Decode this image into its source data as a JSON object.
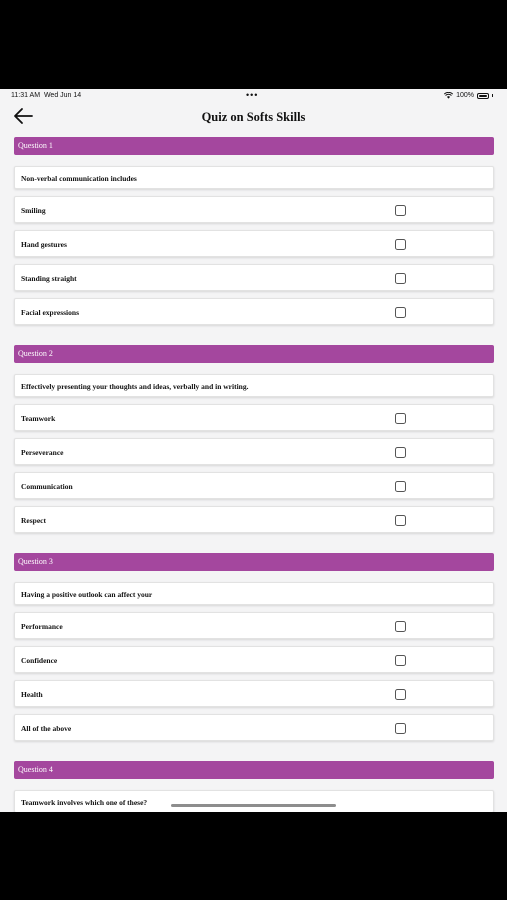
{
  "status": {
    "time": "11:31 AM",
    "date": "Wed Jun 14",
    "dots": "•••",
    "battery": "100%"
  },
  "nav": {
    "title": "Quiz on Softs Skills"
  },
  "questions": [
    {
      "label": "Question 1",
      "text": "Non-verbal communication includes",
      "options": [
        "Smiling",
        "Hand gestures",
        "Standing straight",
        "Facial expressions"
      ]
    },
    {
      "label": "Question 2",
      "text": "Effectively presenting your thoughts and ideas, verbally and in writing.",
      "options": [
        "Teamwork",
        "Perseverance",
        "Communication",
        "Respect"
      ]
    },
    {
      "label": "Question 3",
      "text": "Having a positive outlook can affect your",
      "options": [
        "Performance",
        "Confidence",
        "Health",
        "All of the above"
      ]
    },
    {
      "label": "Question 4",
      "text": "Teamwork involves which one of these?",
      "options": []
    }
  ]
}
